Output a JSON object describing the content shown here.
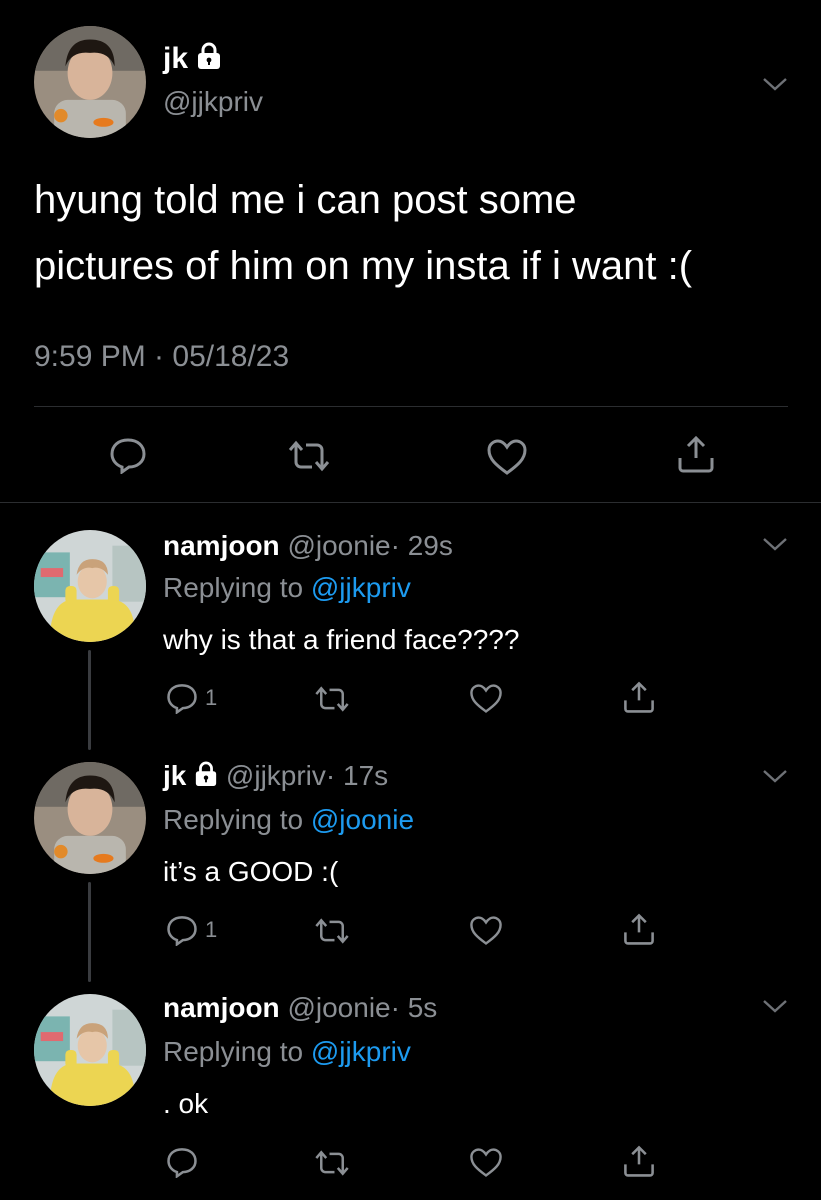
{
  "main_tweet": {
    "display_name": "jk",
    "handle": "@jjkpriv",
    "text_line1": "hyung told me i can post some",
    "text_line2": "pictures of him on my insta if i want :(",
    "timestamp": "9:59 PM · 05/18/23"
  },
  "replies": [
    {
      "display_name": "namjoon",
      "handle": "@joonie",
      "time": "· 29s",
      "replying_prefix": "Replying to",
      "replying_to": "@jjkpriv",
      "text": "why is that a friend face????",
      "reply_count": "1"
    },
    {
      "display_name": "jk",
      "handle": "@jjkpriv",
      "time": "· 17s",
      "replying_prefix": "Replying to",
      "replying_to": "@joonie",
      "text": "it’s a GOOD :(",
      "reply_count": "1"
    },
    {
      "display_name": "namjoon",
      "handle": "@joonie",
      "time": "· 5s",
      "replying_prefix": "Replying to",
      "replying_to": "@jjkpriv",
      "text": ". ok",
      "reply_count": ""
    }
  ],
  "colors": {
    "background": "#000000",
    "muted": "#8b8f94",
    "link": "#1d9bf0"
  },
  "icons": [
    "lock-icon",
    "chevron-down-icon",
    "reply-icon",
    "retweet-icon",
    "like-icon",
    "share-icon"
  ]
}
